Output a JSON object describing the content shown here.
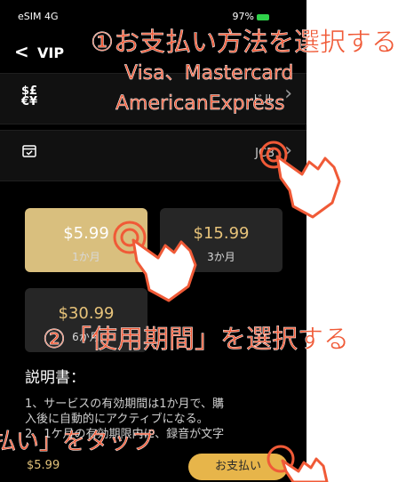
{
  "status_bar": {
    "left": "eSIM 4G",
    "battery": "97%"
  },
  "nav": {
    "back_glyph": "<",
    "title": "VIP"
  },
  "currency_row": {
    "icon": "$£\n€¥",
    "value": "ドル"
  },
  "payment_row": {
    "icon": "card-check-icon",
    "value": "JCB"
  },
  "plans": [
    {
      "price": "$5.99",
      "period": "1か月",
      "selected": true
    },
    {
      "price": "$15.99",
      "period": "3か月",
      "selected": false
    },
    {
      "price": "$30.99",
      "period": "6か月",
      "selected": false
    }
  ],
  "description": {
    "title": "説明書：",
    "lines": [
      "1、サービスの有効期間は1か月で、購",
      "入後に自動的にアクティブになる。",
      "2、1ケ月の有効期限内に、録音が文字"
    ]
  },
  "bottom": {
    "price": "$5.99",
    "pay_label": "お支払い"
  },
  "annotations": {
    "a1": "①お支払い方法を選択する",
    "a2": "Visa、Mastercard",
    "a3": "AmericanExpress",
    "a4": "②「使用期間」を選択する",
    "a5": "払い」をタップ"
  },
  "colors": {
    "annotation": "#f05a37",
    "gold": "#d9bf7e",
    "button": "#e7b54a"
  }
}
